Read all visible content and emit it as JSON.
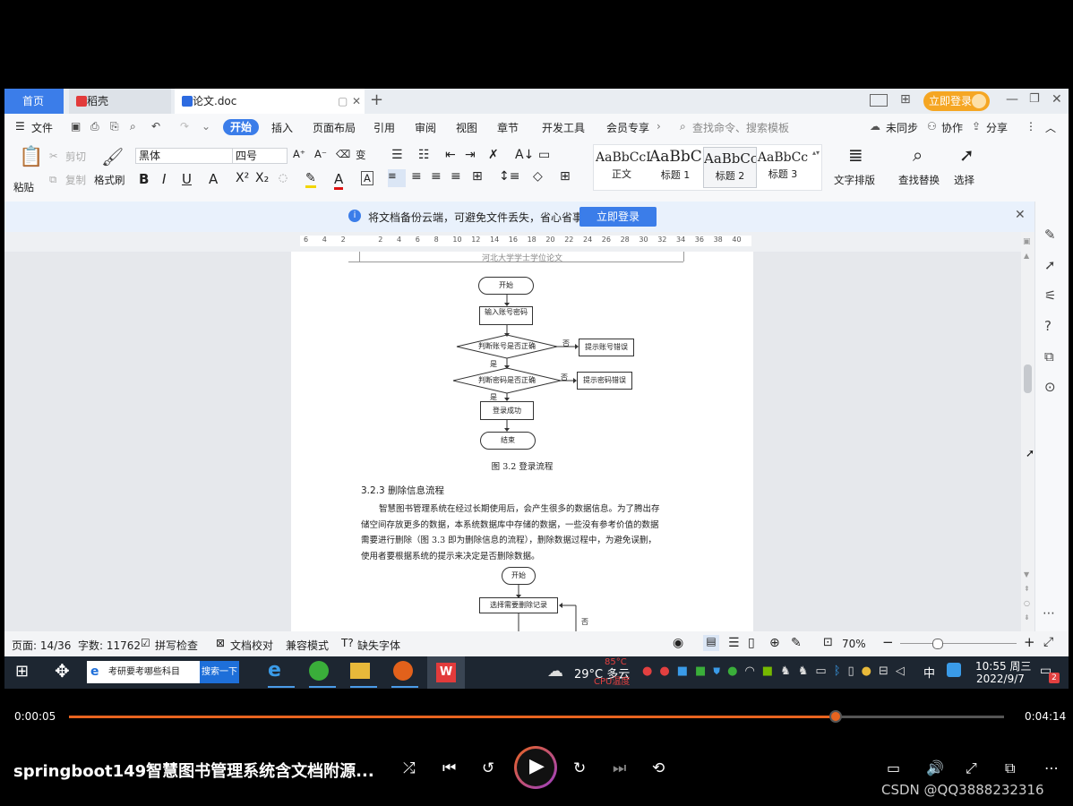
{
  "window": {
    "tabs": {
      "home": "首页",
      "daoke": "稻壳",
      "doc": "论文.doc"
    },
    "login_button": "立即登录",
    "menu": {
      "file": "文件",
      "start": "开始",
      "items": [
        "插入",
        "页面布局",
        "引用",
        "审阅",
        "视图",
        "章节",
        "开发工具",
        "会员专享"
      ],
      "search_placeholder": "查找命令、搜索模板",
      "sync": "未同步",
      "collab": "协作",
      "share": "分享"
    },
    "ribbon": {
      "paste": "粘贴",
      "cut": "剪切",
      "copy": "复制",
      "format_painter": "格式刷",
      "font_name": "黑体",
      "font_size": "四号",
      "styles": [
        {
          "preview": "AaBbCcI",
          "name": "正文"
        },
        {
          "preview": "AaBbC",
          "name": "标题 1"
        },
        {
          "preview": "AaBbCc",
          "name": "标题 2"
        },
        {
          "preview": "AaBbCc",
          "name": "标题 3"
        }
      ],
      "text_layout": "文字排版",
      "find_replace": "查找替换",
      "select": "选择"
    },
    "notice": {
      "text": "将文档备份云端，可避免文件丢失，省心省事",
      "button": "立即登录"
    },
    "ruler_marks": [
      "6",
      "4",
      "2",
      "",
      "2",
      "4",
      "6",
      "8",
      "10",
      "12",
      "14",
      "16",
      "18",
      "20",
      "22",
      "24",
      "26",
      "28",
      "30",
      "32",
      "34",
      "36",
      "38",
      "40"
    ],
    "document": {
      "header": "河北大学学士学位论文",
      "flow1": {
        "start": "开始",
        "input": "输入账号密码",
        "check_account": "判断账号是否正确",
        "account_error": "提示账号错误",
        "check_password": "判断密码是否正确",
        "password_error": "提示密码错误",
        "success": "登录成功",
        "end": "结束",
        "no1": "否",
        "yes1": "是",
        "no2": "否",
        "yes2": "是"
      },
      "caption": "图 3.2  登录流程",
      "section": "3.2.3  删除信息流程",
      "paragraph_lines": [
        "智慧图书管理系统在经过长期使用后，会产生很多的数据信息。为了腾出存",
        "储空间存放更多的数据，本系统数据库中存储的数据，一些没有参考价值的数据",
        "需要进行删除（图 3.3 即为删除信息的流程），删除数据过程中，为避免误删，",
        "使用者要根据系统的提示来决定是否删除数据。"
      ],
      "flow2": {
        "start": "开始",
        "select": "选择需要删除记录",
        "no": "否"
      }
    },
    "status": {
      "page": "页面: 14/36",
      "words": "字数: 11762",
      "spell": "拼写检查",
      "proof": "文档校对",
      "compat": "兼容模式",
      "missing_font": "缺失字体",
      "zoom": "70%"
    }
  },
  "taskbar": {
    "search_text": "考研要考哪些科目",
    "search_button": "搜索一下",
    "weather": "29°C  多云",
    "cpu_temp": "85°C",
    "cpu_label": "CPU温度",
    "ime": "中",
    "time": "10:55 周三",
    "date": "2022/9/7",
    "notif_count": "2"
  },
  "player": {
    "current_time": "0:00:05",
    "total_time": "0:04:14",
    "progress": 0.82,
    "title": "springboot149智慧图书管理系统含文档附源...",
    "watermark": "CSDN @QQ3888232316"
  }
}
